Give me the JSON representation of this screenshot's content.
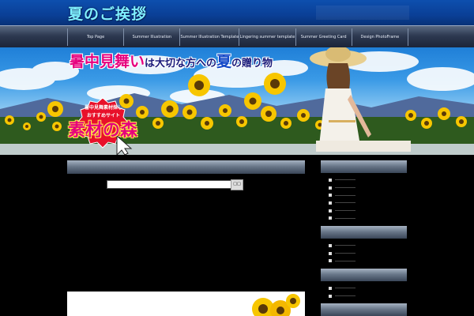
{
  "header": {
    "site_title": "夏のご挨拶"
  },
  "nav": {
    "items": [
      {
        "label": "Top Page"
      },
      {
        "label": "Summer Illustration"
      },
      {
        "label": "Summer Illustration Template"
      },
      {
        "label": "Lingering summer template"
      },
      {
        "label": "Summer Greeting Card"
      },
      {
        "label": "Design PhotoFrame"
      }
    ]
  },
  "banner": {
    "heading_part1": "暑中見舞い",
    "heading_part2": "は大切な方への",
    "heading_part3": "夏",
    "heading_part4": "の贈り物",
    "burst_line1": "暑中見舞素材探し",
    "burst_line2": "おすすめサイト",
    "site_name": "素材の森"
  },
  "search": {
    "button_label": "□□"
  },
  "colors": {
    "header_blue": "#0d4fae",
    "title_cyan": "#7ff0ff",
    "accent_pink": "#e6007e",
    "burst_red": "#e8102a",
    "bar_gray": "#6a788a",
    "background": "#000000"
  }
}
